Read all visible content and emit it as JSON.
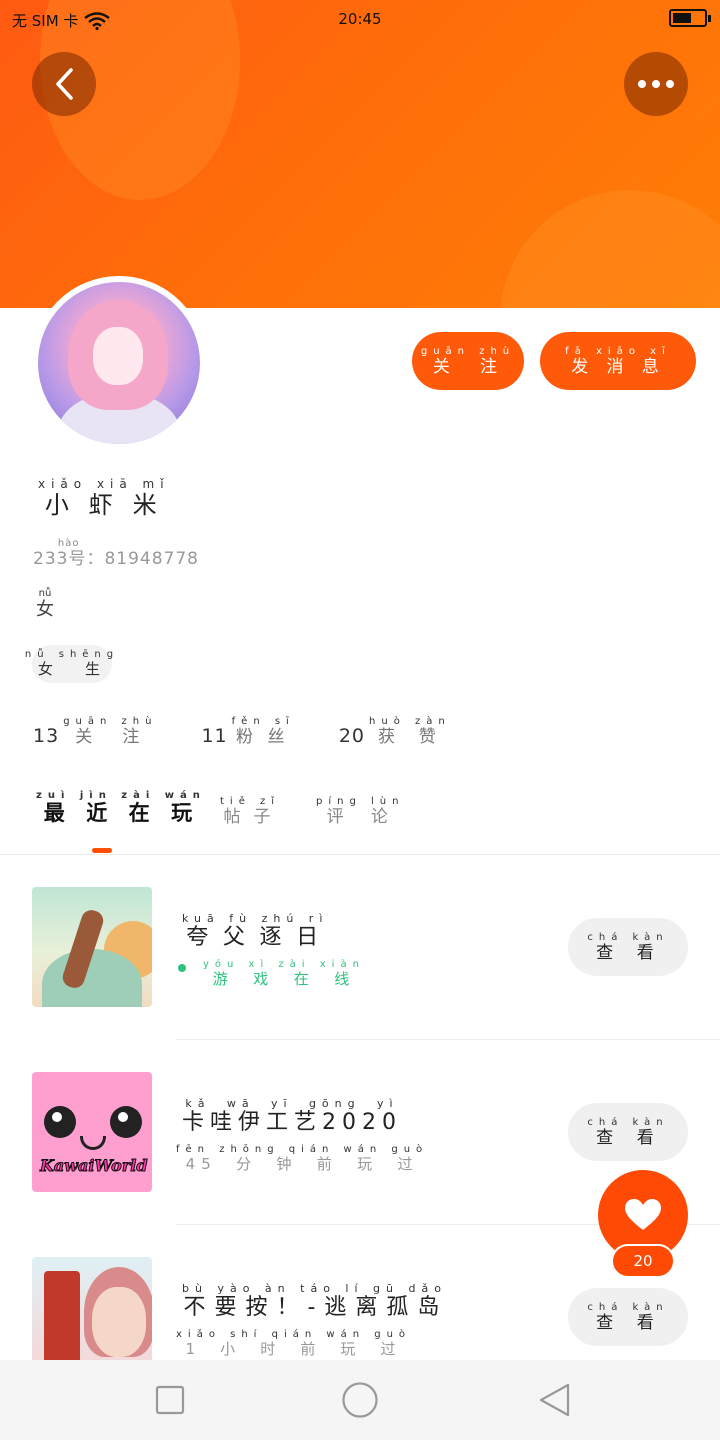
{
  "status_bar": {
    "sim": "无 SIM 卡",
    "time": "20:45"
  },
  "profile": {
    "follow_label": "关注",
    "message_label": "发消息",
    "name": "小虾米",
    "id_prefix": "233号：",
    "id_number": "81948778",
    "gender": "女",
    "tag": "女生"
  },
  "stats": {
    "following_count": "13",
    "following_label": "关注",
    "fans_count": "11",
    "fans_label": "粉丝",
    "likes_count": "20",
    "likes_label": "获赞"
  },
  "tabs": [
    {
      "label": "最近在玩",
      "active": true
    },
    {
      "label": "帖子",
      "active": false
    },
    {
      "label": "评论",
      "active": false
    }
  ],
  "games": [
    {
      "title": "夸父逐日",
      "status": "游戏在线",
      "online": true,
      "button": "查看"
    },
    {
      "title": "卡哇伊工艺2020",
      "status": "45分钟前玩过",
      "online": false,
      "button": "查看",
      "logo_text": "KawaiWorld"
    },
    {
      "title": "不要按！-逃离孤岛",
      "status": "1小时前玩过",
      "online": false,
      "button": "查看"
    }
  ],
  "like_fab": {
    "count": "20"
  },
  "colors": {
    "accent": "#ff5a0a",
    "online": "#2ec27e"
  }
}
